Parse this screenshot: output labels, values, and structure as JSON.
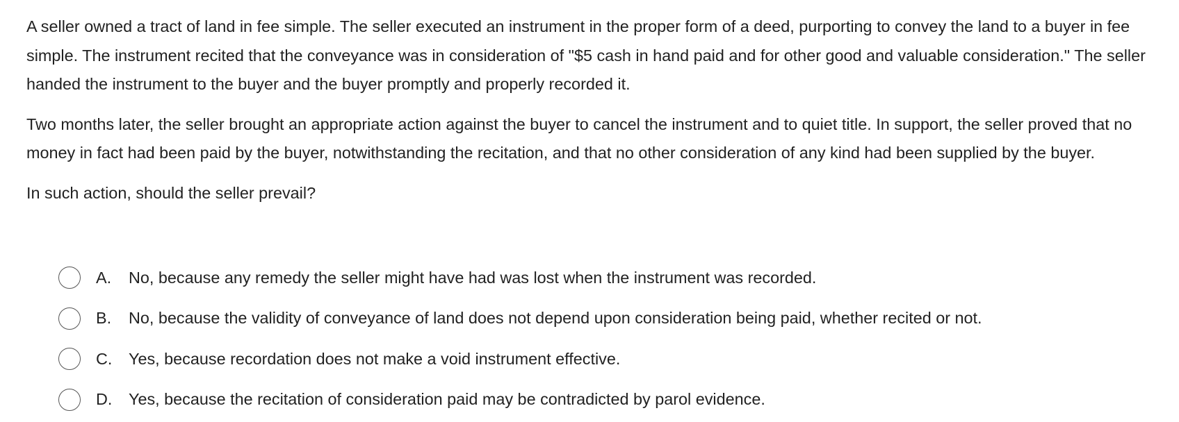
{
  "question": {
    "paragraphs": [
      "A seller owned a tract of land in fee simple.  The seller executed an instrument in the proper form of a deed, purporting to convey the land to a buyer in fee simple.  The instrument recited that the conveyance was in consideration of \"$5 cash in hand paid and for other good and valuable consideration.\"  The seller handed the instrument to the buyer and the buyer promptly and properly recorded it.",
      "Two months later, the seller brought an appropriate action against the buyer to cancel the instrument and to quiet title.  In support, the seller proved that no money in fact had been paid by the buyer, notwithstanding the recitation, and that no other consideration of any kind had been supplied by the buyer."
    ],
    "prompt": "In such action, should the seller prevail?",
    "choices": [
      {
        "letter": "A.",
        "text": "No, because any remedy the seller might have had was lost when the instrument was recorded."
      },
      {
        "letter": "B.",
        "text": "No, because the validity of conveyance of land does not depend upon consideration being paid, whether recited or not."
      },
      {
        "letter": "C.",
        "text": "Yes, because recordation does not make a void instrument effective."
      },
      {
        "letter": "D.",
        "text": "Yes, because the recitation of consideration paid may be contradicted by parol evidence."
      }
    ]
  }
}
